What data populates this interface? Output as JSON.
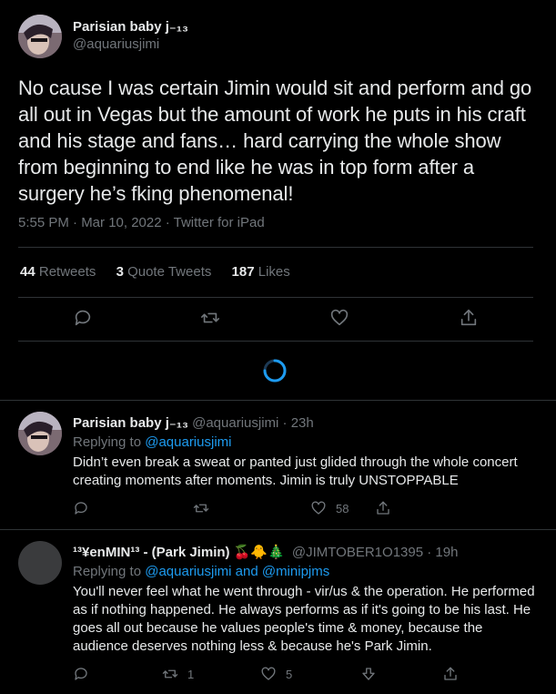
{
  "main_tweet": {
    "display_name": "Parisian baby j₋₁₃",
    "handle": "@aquariusjimi",
    "text": "No cause I was certain Jimin would sit and perform and go all out in Vegas but the amount of work he puts in his craft and his stage and fans… hard carrying the whole show from beginning to end like he was in top form after a surgery he’s fking phenomenal!",
    "meta": "5:55 PM · Mar 10, 2022 · Twitter for iPad",
    "stats": [
      {
        "num": "44",
        "label": "Retweets"
      },
      {
        "num": "3",
        "label": "Quote Tweets"
      },
      {
        "num": "187",
        "label": "Likes"
      }
    ],
    "actions": [
      "reply-icon",
      "retweet-icon",
      "like-icon",
      "share-icon"
    ]
  },
  "replies": [
    {
      "display_name": "Parisian baby j₋₁₃",
      "handle_time": "@aquariusjimi · 23h",
      "replying_prefix": "Replying to ",
      "replying_to": "@aquariusjimi",
      "text": "Didn’t even break a sweat or panted just glided through the whole concert creating moments after moments. Jimin is truly UNSTOPPABLE",
      "retweets": "",
      "likes": "58"
    },
    {
      "display_name": "¹³¥enMIN¹³ - (Park Jimin) 🍒🐥🎄",
      "handle_time": "@JIMTOBER1O1395 · 19h",
      "replying_prefix": "Replying to ",
      "replying_to": "@aquariusjimi and @minipjms",
      "text": "You'll never feel what he went through - vir/us & the operation. He performed as if nothing happened. He always performs as if it's going to be his last. He goes all out because he values people's time & money, because the audience deserves nothing less & because he's Park Jimin.",
      "retweets": "1",
      "likes": "5"
    }
  ],
  "colors": {
    "background": "#000000",
    "text": "#e7e9ea",
    "secondary": "#71767b",
    "link": "#1d9bf0",
    "divider": "#2f3336"
  }
}
